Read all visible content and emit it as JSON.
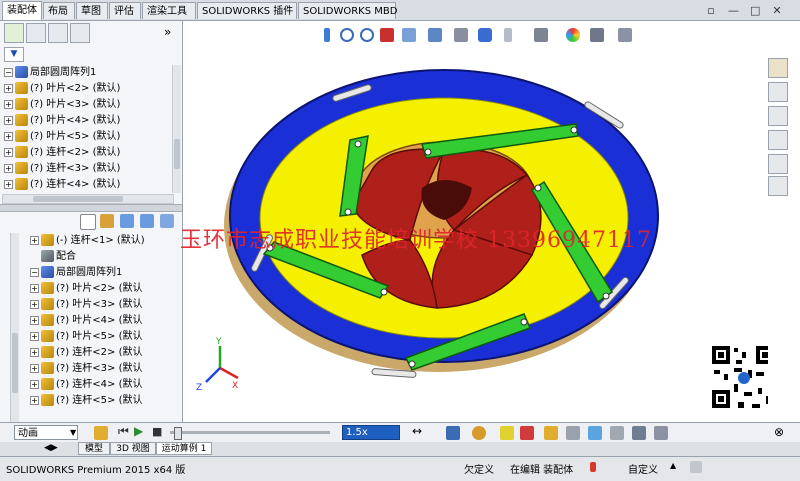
{
  "tabs": [
    "装配体",
    "布局",
    "草图",
    "评估",
    "渲染工具",
    "SOLIDWORKS 插件",
    "SOLIDWORKS MBD"
  ],
  "window_controls": {
    "restore": "▫",
    "minimize": "—",
    "maximize": "□",
    "close": "✕"
  },
  "panel": {
    "expand_label": "»"
  },
  "tree_top": [
    {
      "exp": "−",
      "label": "局部圆周阵列1",
      "icon": "pattern"
    },
    {
      "exp": "+",
      "label": "(?) 叶片<2> (默认)",
      "icon": "part"
    },
    {
      "exp": "+",
      "label": "(?) 叶片<3> (默认)",
      "icon": "part"
    },
    {
      "exp": "+",
      "label": "(?) 叶片<4> (默认)",
      "icon": "part"
    },
    {
      "exp": "+",
      "label": "(?) 叶片<5> (默认)",
      "icon": "part"
    },
    {
      "exp": "+",
      "label": "(?) 连杆<2> (默认)",
      "icon": "part"
    },
    {
      "exp": "+",
      "label": "(?) 连杆<3> (默认)",
      "icon": "part"
    },
    {
      "exp": "+",
      "label": "(?) 连杆<4> (默认)",
      "icon": "part"
    }
  ],
  "tree_bottom": [
    {
      "exp": "+",
      "label": "(-) 连杆<1> (默认)",
      "icon": "part"
    },
    {
      "exp": "",
      "label": "配合",
      "icon": "mate"
    },
    {
      "exp": "−",
      "label": "局部圆周阵列1",
      "icon": "pattern"
    },
    {
      "exp": "+",
      "label": "(?) 叶片<2> (默认",
      "icon": "part"
    },
    {
      "exp": "+",
      "label": "(?) 叶片<3> (默认",
      "icon": "part"
    },
    {
      "exp": "+",
      "label": "(?) 叶片<4> (默认",
      "icon": "part"
    },
    {
      "exp": "+",
      "label": "(?) 叶片<5> (默认",
      "icon": "part"
    },
    {
      "exp": "+",
      "label": "(?) 连杆<2> (默认",
      "icon": "part"
    },
    {
      "exp": "+",
      "label": "(?) 连杆<3> (默认",
      "icon": "part"
    },
    {
      "exp": "+",
      "label": "(?) 连杆<4> (默认",
      "icon": "part"
    },
    {
      "exp": "+",
      "label": "(?) 连杆<5> (默认",
      "icon": "part"
    }
  ],
  "watermark": "玉环市志成职业技能培训学校  13396947117",
  "triad": {
    "x": "X",
    "y": "Y",
    "z": "Z"
  },
  "motion": {
    "study_type": "动画",
    "speed": "1.5x"
  },
  "bottom_tabs": [
    "模型",
    "3D 视图",
    "运动算例 1"
  ],
  "status": {
    "product": "SOLIDWORKS Premium 2015 x64 版",
    "definition": "欠定义",
    "editing": "在编辑 装配体",
    "custom": "自定义"
  },
  "colors": {
    "ring_blue": "#1a2fd6",
    "plate_yellow": "#f4f000",
    "blade_red": "#b0201a",
    "link_green": "#33cc33",
    "watermark_red": "#e0242b"
  }
}
